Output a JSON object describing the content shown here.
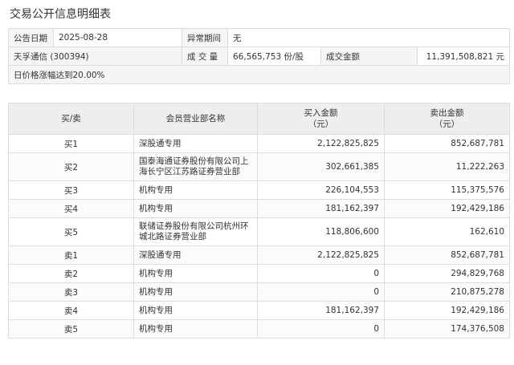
{
  "title": "交易公开信息明细表",
  "info": {
    "announce_date_label": "公告日期",
    "announce_date": "2025-08-28",
    "abnormal_period_label": "异常期间",
    "abnormal_period": "无",
    "stock": "天孚通信 (300394)",
    "volume_label": "成 交 量",
    "volume": "66,565,753 份/股",
    "amount_label": "成交金额",
    "amount": "11,391,508,821 元",
    "reason": "日价格涨幅达到20.00%"
  },
  "columns": {
    "side": "买/卖",
    "dept": "会员营业部名称",
    "buy": "买入金额\n（元）",
    "sell": "卖出金额\n（元）"
  },
  "rows": [
    {
      "side": "买1",
      "dept": "深股通专用",
      "buy": "2,122,825,825",
      "sell": "852,687,781"
    },
    {
      "side": "买2",
      "dept": "国泰海通证券股份有限公司上海长宁区江苏路证券营业部",
      "buy": "302,661,385",
      "sell": "11,222,263"
    },
    {
      "side": "买3",
      "dept": "机构专用",
      "buy": "226,104,553",
      "sell": "115,375,576"
    },
    {
      "side": "买4",
      "dept": "机构专用",
      "buy": "181,162,397",
      "sell": "192,429,186"
    },
    {
      "side": "买5",
      "dept": "联储证券股份有限公司杭州环城北路证券营业部",
      "buy": "118,806,600",
      "sell": "162,610"
    },
    {
      "side": "卖1",
      "dept": "深股通专用",
      "buy": "2,122,825,825",
      "sell": "852,687,781"
    },
    {
      "side": "卖2",
      "dept": "机构专用",
      "buy": "0",
      "sell": "294,829,768"
    },
    {
      "side": "卖3",
      "dept": "机构专用",
      "buy": "0",
      "sell": "210,875,278"
    },
    {
      "side": "卖4",
      "dept": "机构专用",
      "buy": "181,162,397",
      "sell": "192,429,186"
    },
    {
      "side": "卖5",
      "dept": "机构专用",
      "buy": "0",
      "sell": "174,376,508"
    }
  ]
}
